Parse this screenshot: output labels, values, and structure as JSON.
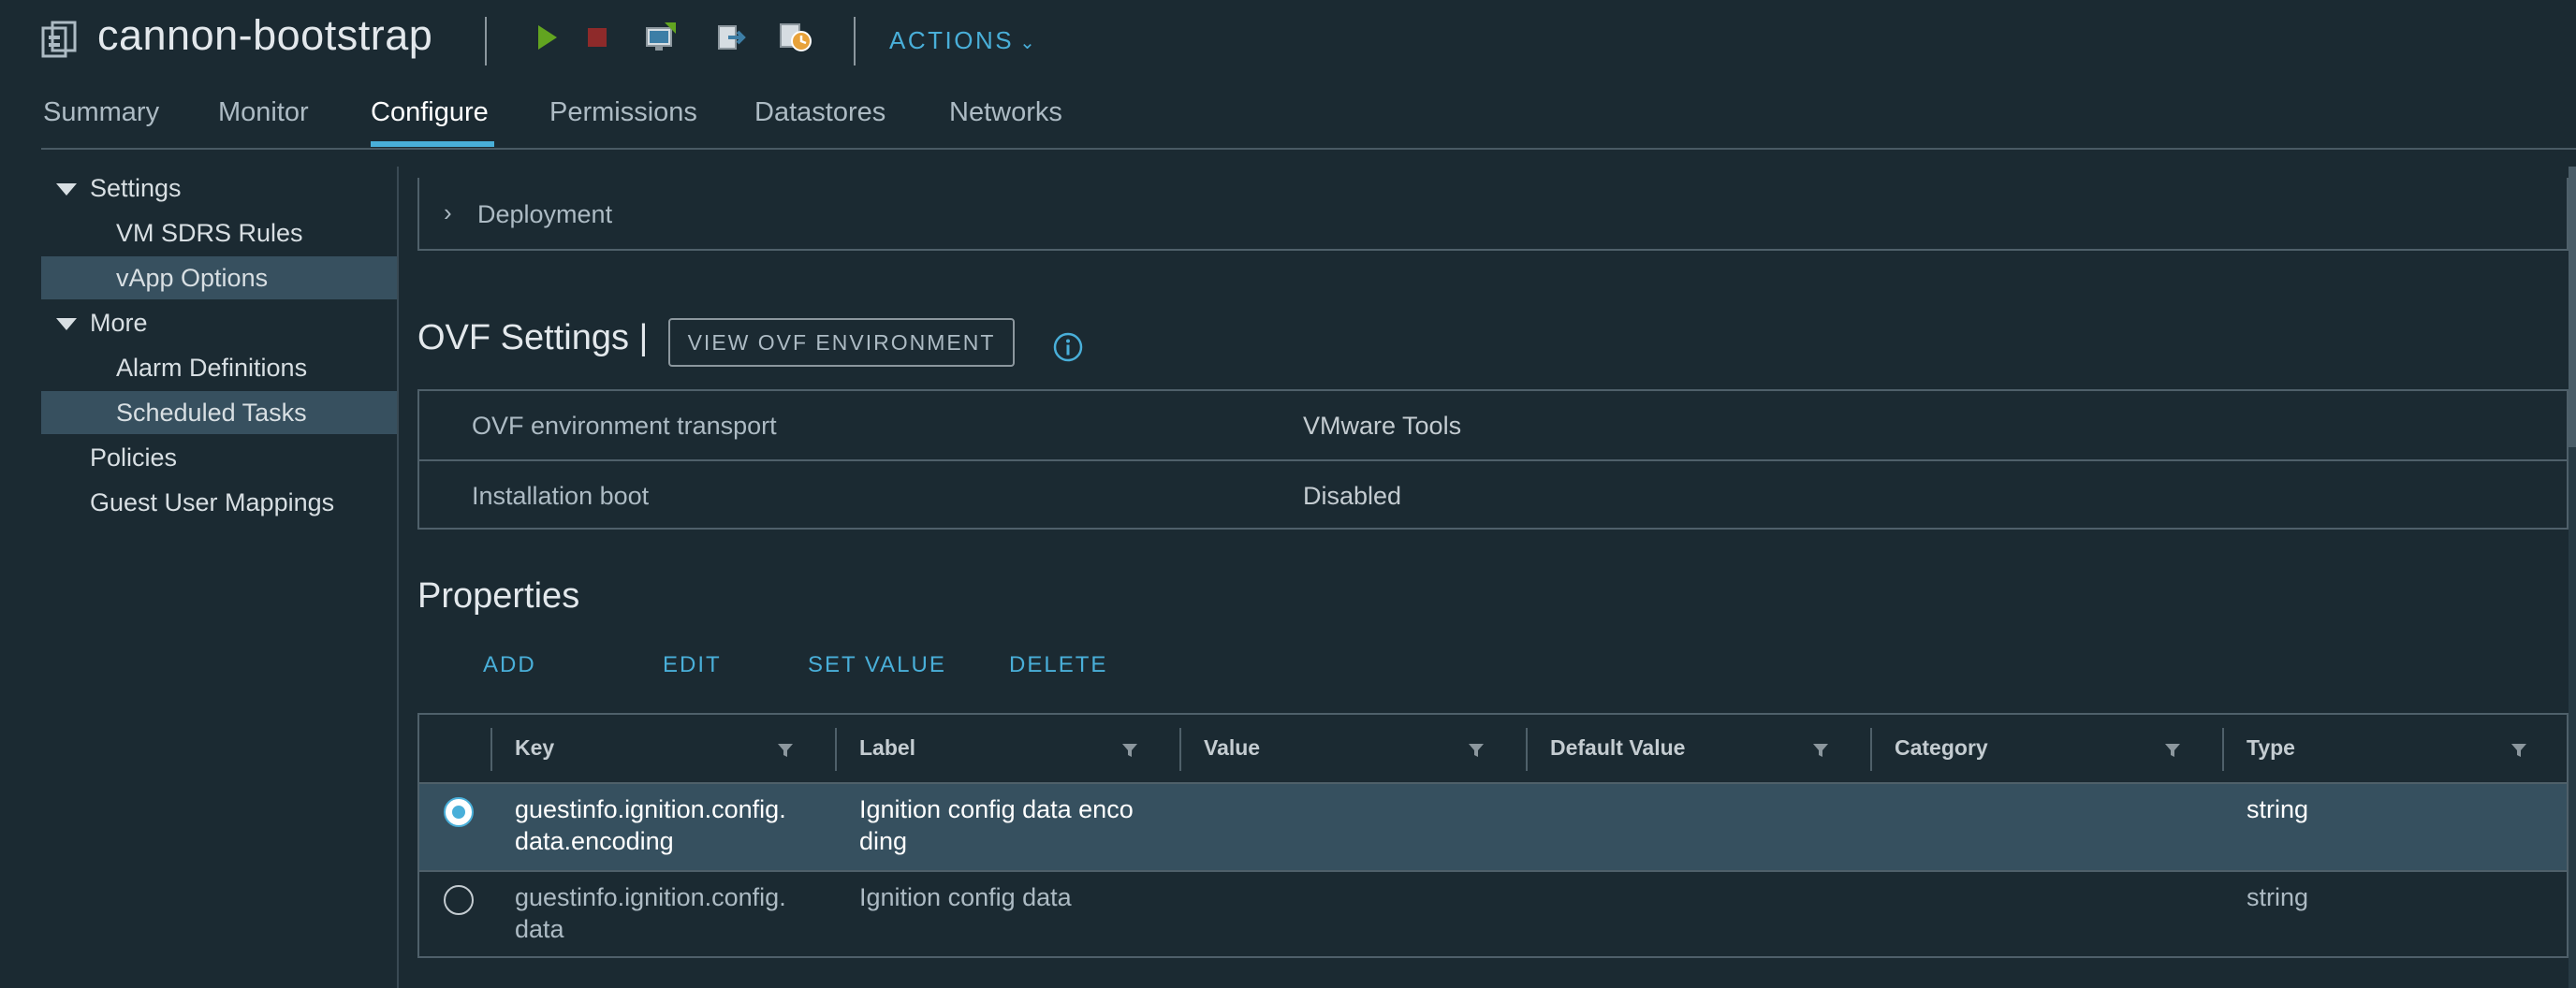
{
  "header": {
    "title": "cannon-bootstrap",
    "icons": [
      "vm-icon",
      "power-on-icon",
      "power-off-icon",
      "launch-console-icon",
      "migrate-icon",
      "snapshot-icon"
    ],
    "actions_label": "ACTIONS"
  },
  "tabs": [
    {
      "label": "Summary"
    },
    {
      "label": "Monitor"
    },
    {
      "label": "Configure",
      "active": true
    },
    {
      "label": "Permissions"
    },
    {
      "label": "Datastores"
    },
    {
      "label": "Networks"
    }
  ],
  "sidebar": {
    "items": [
      {
        "label": "Settings",
        "expandable": true
      },
      {
        "label": "VM SDRS Rules"
      },
      {
        "label": "vApp Options",
        "selected": true
      },
      {
        "label": "More",
        "expandable": true
      },
      {
        "label": "Alarm Definitions"
      },
      {
        "label": "Scheduled Tasks",
        "selected": true
      },
      {
        "label": "Policies"
      },
      {
        "label": "Guest User Mappings"
      }
    ]
  },
  "deployment": {
    "label": "Deployment"
  },
  "ovf": {
    "title": "OVF Settings |",
    "view_button": "VIEW OVF ENVIRONMENT",
    "rows": [
      {
        "key": "OVF environment transport",
        "value": "VMware Tools"
      },
      {
        "key": "Installation boot",
        "value": "Disabled"
      }
    ]
  },
  "properties": {
    "title": "Properties",
    "buttons": [
      "ADD",
      "EDIT",
      "SET VALUE",
      "DELETE"
    ],
    "columns": [
      "Key",
      "Label",
      "Value",
      "Default Value",
      "Category",
      "Type"
    ],
    "rows": [
      {
        "selected": true,
        "key": [
          "guestinfo.ignition.config.",
          "data.encoding"
        ],
        "label": [
          "Ignition config data enco",
          "ding"
        ],
        "value": "",
        "default_value": "",
        "category": "",
        "type": "string"
      },
      {
        "selected": false,
        "key": [
          "guestinfo.ignition.config.",
          "data"
        ],
        "label": [
          "Ignition config data"
        ],
        "value": "",
        "default_value": "",
        "category": "",
        "type": "string"
      }
    ]
  },
  "colors": {
    "background": "#1b2a32",
    "accent": "#49afd9",
    "selected_row": "#36505f",
    "border": "#4f606a",
    "power_on": "#62a420",
    "power_off": "#c92100"
  }
}
